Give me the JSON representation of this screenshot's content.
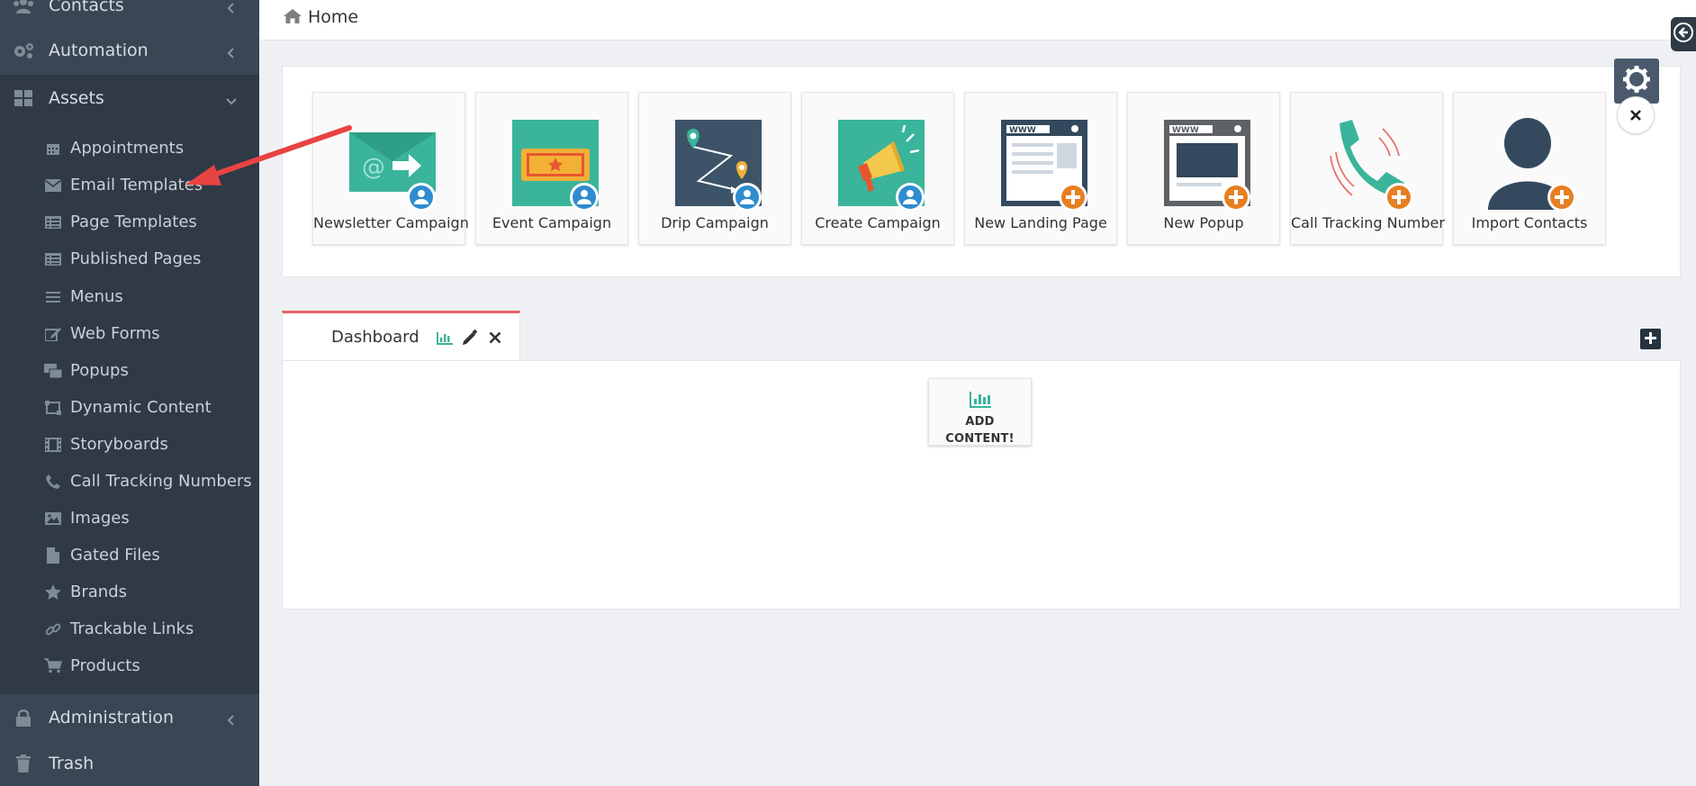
{
  "sidebar": {
    "contacts": "Contacts",
    "automation": "Automation",
    "assets": "Assets",
    "administration": "Administration",
    "trash": "Trash",
    "submenu": [
      {
        "label": "Appointments",
        "icon": "calendar-icon"
      },
      {
        "label": "Email Templates",
        "icon": "envelope-icon"
      },
      {
        "label": "Page Templates",
        "icon": "list-alt-icon"
      },
      {
        "label": "Published Pages",
        "icon": "list-alt-icon"
      },
      {
        "label": "Menus",
        "icon": "bars-icon"
      },
      {
        "label": "Web Forms",
        "icon": "edit-icon"
      },
      {
        "label": "Popups",
        "icon": "popup-icon"
      },
      {
        "label": "Dynamic Content",
        "icon": "dynamic-content-icon"
      },
      {
        "label": "Storyboards",
        "icon": "film-icon"
      },
      {
        "label": "Call Tracking Numbers",
        "icon": "phone-icon"
      },
      {
        "label": "Images",
        "icon": "image-icon"
      },
      {
        "label": "Gated Files",
        "icon": "file-icon"
      },
      {
        "label": "Brands",
        "icon": "star-icon"
      },
      {
        "label": "Trackable Links",
        "icon": "link-icon"
      },
      {
        "label": "Products",
        "icon": "cart-icon"
      }
    ]
  },
  "breadcrumb": {
    "home": "Home"
  },
  "quick_actions": [
    {
      "label": "Newsletter Campaign"
    },
    {
      "label": "Event Campaign"
    },
    {
      "label": "Drip Campaign"
    },
    {
      "label": "Create Campaign"
    },
    {
      "label": "New Landing Page"
    },
    {
      "label": "New Popup"
    },
    {
      "label": "Call Tracking Number"
    },
    {
      "label": "Import Contacts"
    }
  ],
  "dashboard": {
    "tab_label": "Dashboard",
    "add_content_label": "ADD CONTENT!"
  },
  "colors": {
    "sidebar_bg": "#394654",
    "submenu_bg": "#2f3a46",
    "teal": "#3ab49a",
    "navy": "#34495e",
    "orange": "#e67e22",
    "blue_badge": "#2f8ccf",
    "tab_accent": "#e8606a",
    "arrow_red": "#e84343"
  }
}
